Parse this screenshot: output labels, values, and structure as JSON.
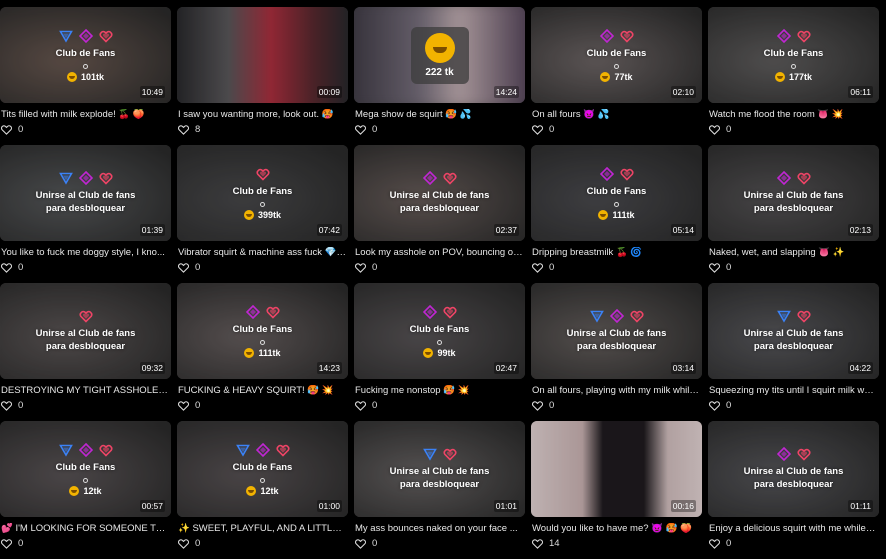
{
  "cards": [
    {
      "type": "locked",
      "icons": [
        "tri",
        "dia",
        "heart"
      ],
      "label": "Club de Fans",
      "price": "101tk",
      "duration": "10:49",
      "title": "Tits filled with milk explode! 🍒 🍑",
      "likes": "0",
      "bg": "#6b5a52"
    },
    {
      "type": "preview",
      "duration": "00:09",
      "title": "I saw you wanting more, look out. 🥵",
      "likes": "8",
      "bg": "#5a3a3c"
    },
    {
      "type": "tip",
      "price": "222 tk",
      "duration": "14:24",
      "title": "Mega show de squirt 🥵 💦",
      "likes": "0",
      "bg": "#7a6a70"
    },
    {
      "type": "locked",
      "icons": [
        "dia",
        "heart"
      ],
      "label": "Club de Fans",
      "price": "77tk",
      "duration": "02:10",
      "title": "On all fours 👿 💦",
      "likes": "0",
      "bg": "#706868"
    },
    {
      "type": "locked",
      "icons": [
        "dia",
        "heart"
      ],
      "label": "Club de Fans",
      "price": "177tk",
      "duration": "06:11",
      "title": "Watch me flood the room 👅 💥",
      "likes": "0",
      "bg": "#626060"
    },
    {
      "type": "unlock",
      "icons": [
        "tri",
        "dia",
        "heart"
      ],
      "label": "Unirse al Club de fans",
      "label2": "para desbloquear",
      "duration": "01:39",
      "title": "You like to fuck me doggy style, I kno...",
      "likes": "0",
      "bg": "#585a5c"
    },
    {
      "type": "locked",
      "icons": [
        "heart"
      ],
      "label": "Club de Fans",
      "price": "399tk",
      "duration": "07:42",
      "title": "Vibrator squirt & machine ass fuck 💎 ...",
      "likes": "0",
      "bg": "#4a4a4c"
    },
    {
      "type": "unlock",
      "icons": [
        "dia",
        "heart"
      ],
      "label": "Unirse al Club de fans",
      "label2": "para desbloquear",
      "duration": "02:37",
      "title": "Look my asshole on POV, bouncing on...",
      "likes": "0",
      "bg": "#6a5f5c"
    },
    {
      "type": "locked",
      "icons": [
        "dia",
        "heart"
      ],
      "label": "Club de Fans",
      "price": "111tk",
      "duration": "05:14",
      "title": "Dripping breastmilk 🍒 🌀",
      "likes": "0",
      "bg": "#4c4c50"
    },
    {
      "type": "unlock",
      "icons": [
        "dia",
        "heart"
      ],
      "label": "Unirse al Club de fans",
      "label2": "para desbloquear",
      "duration": "02:13",
      "title": "Naked, wet, and slapping 👅 ✨",
      "likes": "0",
      "bg": "#565456"
    },
    {
      "type": "unlock",
      "icons": [
        "heart"
      ],
      "label": "Unirse al Club de fans",
      "label2": "para desbloquear",
      "duration": "09:32",
      "title": "DESTROYING MY TIGHT ASSHOLE 🥵 ...",
      "likes": "0",
      "bg": "#5e5858"
    },
    {
      "type": "locked",
      "icons": [
        "dia",
        "heart"
      ],
      "label": "Club de Fans",
      "price": "111tk",
      "duration": "14:23",
      "title": "FUCKING & HEAVY SQUIRT! 🥵 💥",
      "likes": "0",
      "bg": "#686060"
    },
    {
      "type": "locked",
      "icons": [
        "dia",
        "heart"
      ],
      "label": "Club de Fans",
      "price": "99tk",
      "duration": "02:47",
      "title": "Fucking me nonstop 🥵 💥",
      "likes": "0",
      "bg": "#5a5658"
    },
    {
      "type": "unlock",
      "icons": [
        "tri",
        "dia",
        "heart"
      ],
      "label": "Unirse al Club de fans",
      "label2": "para desbloquear",
      "duration": "03:14",
      "title": "On all fours, playing with my milk while...",
      "likes": "0",
      "bg": "#66605e"
    },
    {
      "type": "unlock",
      "icons": [
        "tri",
        "heart"
      ],
      "label": "Unirse al Club de fans",
      "label2": "para desbloquear",
      "duration": "04:22",
      "title": "Squeezing my tits until I squirt milk whi...",
      "likes": "0",
      "bg": "#5a5a5e"
    },
    {
      "type": "locked",
      "icons": [
        "tri",
        "dia",
        "heart"
      ],
      "label": "Club de Fans",
      "price": "12tk",
      "duration": "00:57",
      "title": "💕 I'M LOOKING FOR SOMEONE TO H...",
      "likes": "0",
      "bg": "#5c5658"
    },
    {
      "type": "locked",
      "icons": [
        "tri",
        "dia",
        "heart"
      ],
      "label": "Club de Fans",
      "price": "12tk",
      "duration": "01:00",
      "title": "✨ SWEET, PLAYFUL, AND A LITTLE D...",
      "likes": "0",
      "bg": "#5a5456"
    },
    {
      "type": "unlock",
      "icons": [
        "tri",
        "heart"
      ],
      "label": "Unirse al Club de fans",
      "label2": "para desbloquear",
      "duration": "01:01",
      "title": "My ass bounces naked on your face ...",
      "likes": "0",
      "bg": "#686464"
    },
    {
      "type": "preview2",
      "duration": "00:16",
      "title": "Would you like to have me? 👿 🥵 🍑",
      "likes": "14",
      "bg": "#d8c8c8"
    },
    {
      "type": "unlock",
      "icons": [
        "dia",
        "heart"
      ],
      "label": "Unirse al Club de fans",
      "label2": "para desbloquear",
      "duration": "01:11",
      "title": "Enjoy a delicious squirt with me while I...",
      "likes": "0",
      "bg": "#58585c"
    }
  ]
}
